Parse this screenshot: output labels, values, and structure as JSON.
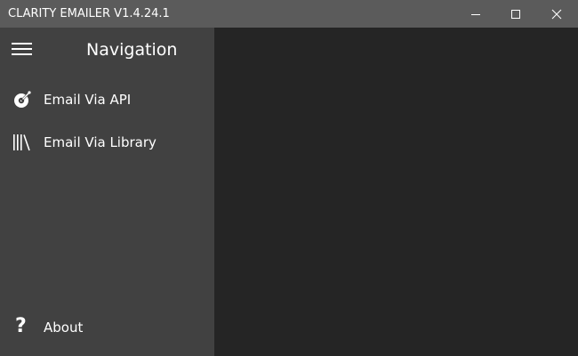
{
  "window": {
    "title": "CLARITY EMAILER V1.4.24.1",
    "controls": [
      "minimize-icon",
      "maximize-icon",
      "close-icon"
    ]
  },
  "sidebar": {
    "menu_icon": "hamburger-icon",
    "title": "Navigation",
    "items": [
      {
        "label": "Email Via API",
        "icon": "disc-icon"
      },
      {
        "label": "Email Via Library",
        "icon": "library-icon"
      }
    ],
    "footer": {
      "label": "About",
      "icon": "help-icon"
    }
  },
  "colors": {
    "titlebar": "#5b5b5b",
    "sidebar": "#414141",
    "content": "#252525",
    "text": "#ffffff"
  }
}
